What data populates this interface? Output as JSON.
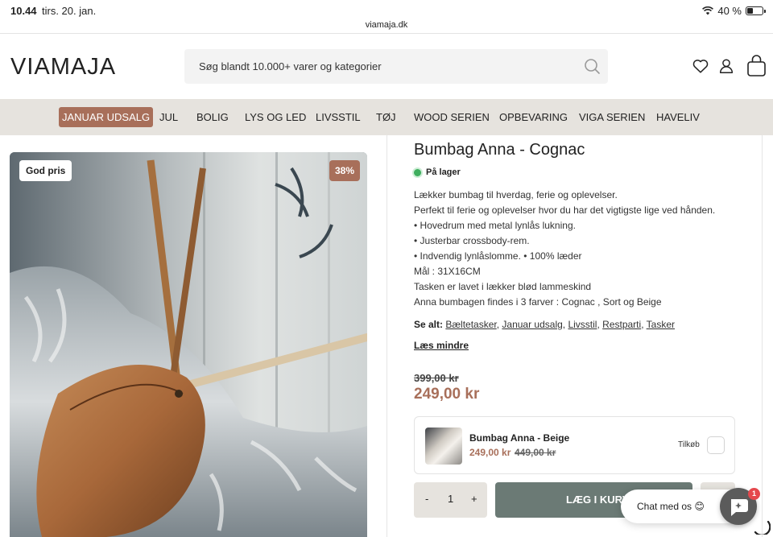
{
  "status": {
    "time": "10.44",
    "date": "tirs. 20. jan.",
    "battery": "40 %",
    "battery_level": 0.4
  },
  "browser": {
    "url": "viamaja.dk"
  },
  "header": {
    "logo": "VIAMAJA",
    "search_placeholder": "Søg blandt 10.000+ varer og kategorier",
    "icons": [
      "heart-icon",
      "user-icon",
      "bag-icon"
    ]
  },
  "nav": {
    "items": [
      {
        "label": "JANUAR UDSALG",
        "active": true
      },
      {
        "label": "JUL"
      },
      {
        "label": "BOLIG"
      },
      {
        "label": "LYS OG LED"
      },
      {
        "label": "LIVSSTIL"
      },
      {
        "label": "TØJ"
      },
      {
        "label": "WOOD SERIEN"
      },
      {
        "label": "OPBEVARING"
      },
      {
        "label": "VIGA SERIEN"
      },
      {
        "label": "HAVELIV"
      }
    ]
  },
  "product": {
    "badge_left": "God pris",
    "badge_discount": "38%",
    "title": "Bumbag Anna - Cognac",
    "stock": "På lager",
    "description": [
      "Lækker bumbag til hverdag, ferie og oplevelser.",
      "Perfekt til ferie og oplevelser hvor du har det vigtigste lige ved hånden.",
      "• Hovedrum med metal lynlås lukning.",
      "• Justerbar crossbody-rem.",
      "• Indvendig lynlåslomme. • 100% læder",
      "Mål : 31X16CM",
      "Tasken er lavet i lækker blød lammeskind",
      "Anna bumbagen findes i 3 farver : Cognac , Sort og Beige"
    ],
    "see_all_label": "Se alt:",
    "see_all_links": [
      "Bæltetasker",
      "Januar udsalg",
      "Livsstil",
      "Restparti",
      "Tasker"
    ],
    "read_less": "Læs mindre",
    "old_price": "399,00 kr",
    "price": "249,00 kr"
  },
  "addon": {
    "name": "Bumbag Anna - Beige",
    "price": "249,00 kr",
    "old_price": "449,00 kr",
    "label": "Tilkøb"
  },
  "cart": {
    "minus": "-",
    "quantity": "1",
    "plus": "+",
    "add_label": "LÆG I KURV"
  },
  "chat": {
    "label": "Chat med os 😊",
    "badge": "1"
  },
  "colors": {
    "accent": "#a86f5a",
    "nav_bg": "#e6e3de",
    "cart_btn": "#6b7a75"
  }
}
